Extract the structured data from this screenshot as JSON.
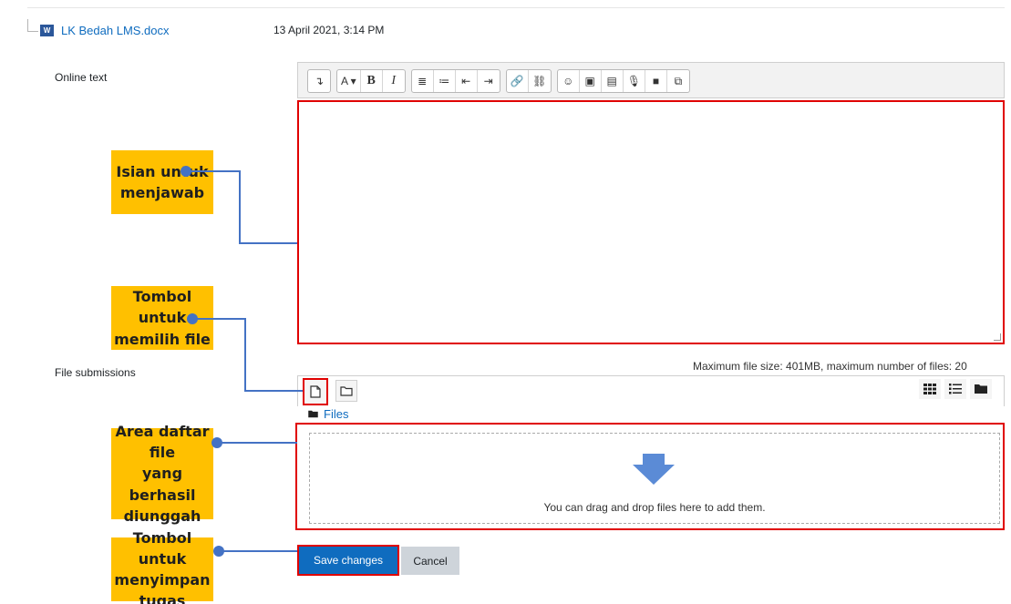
{
  "file": {
    "icon_text": "W",
    "name": "LK Bedah LMS.docx",
    "date": "13 April 2021, 3:14 PM"
  },
  "labels": {
    "online_text": "Online text",
    "file_submissions": "File submissions"
  },
  "editor": {
    "toolbar_groups": [
      [
        "↴"
      ],
      [
        "A ▾",
        "B",
        "I"
      ],
      [
        "≣",
        "≔",
        "⇤",
        "⇥"
      ],
      [
        "🔗",
        "⛓"
      ],
      [
        "☺",
        "▣",
        "▤",
        "🎙",
        "■",
        "⧉"
      ]
    ]
  },
  "filemanager": {
    "limits": "Maximum file size: 401MB, maximum number of files: 20",
    "path_label": "Files",
    "drop_text": "You can drag and drop files here to add them."
  },
  "buttons": {
    "save": "Save changes",
    "cancel": "Cancel"
  },
  "callouts": {
    "answer_area": [
      "Isian untuk",
      "menjawab"
    ],
    "choose_file": [
      "Tombol untuk",
      "memilih file"
    ],
    "file_list": [
      "Area daftar file",
      "yang berhasil",
      "diunggah"
    ],
    "save_task": [
      "Tombol untuk",
      "menyimpan tugas"
    ]
  },
  "colors": {
    "callout_bg": "#ffc000",
    "connector": "#4472c4",
    "highlight": "#e00000",
    "primary": "#0f6cbf"
  }
}
